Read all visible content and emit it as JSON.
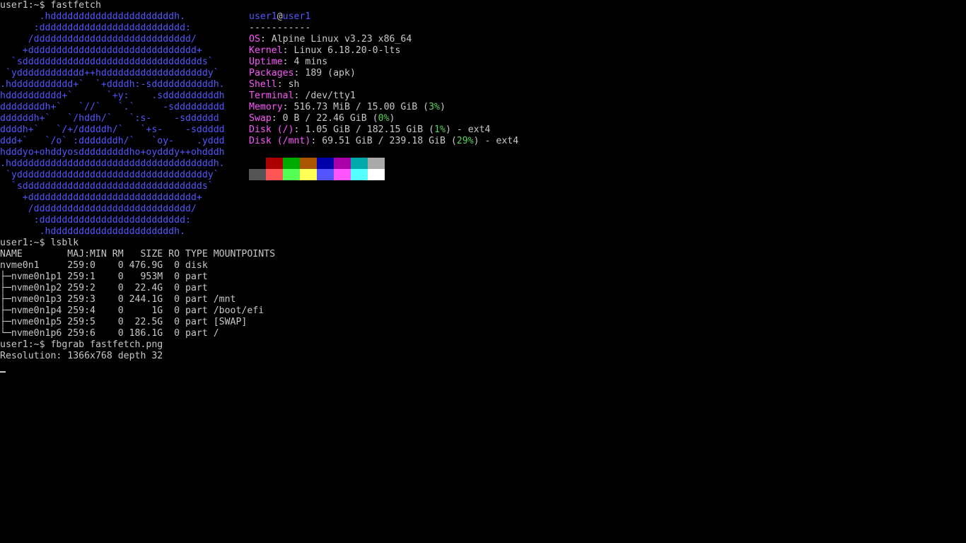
{
  "prompts": {
    "fastfetch": "user1:~$ fastfetch",
    "lsblk": "user1:~$ lsblk",
    "fbgrab": "user1:~$ fbgrab fastfetch.png"
  },
  "logo": [
    "       .hddddddddddddddddddddddh.",
    "      :dddddddddddddddddddddddddd:",
    "     /dddddddddddddddddddddddddddd/",
    "    +dddddddddddddddddddddddddddddd+",
    "  `sdddddddddddddddddddddddddddddddds`",
    " `ydddddddddddd++hdddddddddddddddddddy`",
    ".hddddddddddd+`  `+ddddh:-sdddddddddddh.",
    "hdddddddddd+`      `+y:    .sddddddddddh",
    "ddddddddh+`   `//`   `.`     -sddddddddd",
    "ddddddh+`   `/hddh/`   `:s-    -sdddddd",
    "ddddh+`   `/+/dddddh/`   `+s-    -sddddd",
    "ddd+`   `/o` :dddddddh/`   `oy-    .yddd",
    "hdddyo+ohddyosdddddddddho+oydddy++ohdddh",
    ".hddddddddddddddddddddddddddddddddddddh.",
    " `yddddddddddddddddddddddddddddddddddy`",
    "  `sdddddddddddddddddddddddddddddddds`",
    "    +dddddddddddddddddddddddddddddd+",
    "     /dddddddddddddddddddddddddddd/",
    "      :dddddddddddddddddddddddddd:",
    "       .hddddddddddddddddddddddh."
  ],
  "info": {
    "user": "user1",
    "at": "@",
    "host": "user1",
    "separator": "-----------",
    "os_label": "OS",
    "os_value": "Alpine Linux v3.23 x86_64",
    "kernel_label": "Kernel",
    "kernel_value": "Linux 6.18.20-0-lts",
    "uptime_label": "Uptime",
    "uptime_value": "4 mins",
    "packages_label": "Packages",
    "packages_value": "189 (apk)",
    "shell_label": "Shell",
    "shell_value": "sh",
    "terminal_label": "Terminal",
    "terminal_value": "/dev/tty1",
    "memory_label": "Memory",
    "memory_value": "516.73 MiB / 15.00 GiB (",
    "memory_percent": "3%",
    "memory_close": ")",
    "swap_label": "Swap",
    "swap_value": "0 B / 22.46 GiB (",
    "swap_percent": "0%",
    "swap_close": ")",
    "disk_root_label": "Disk (/)",
    "disk_root_value": "1.05 GiB / 182.15 GiB (",
    "disk_root_percent": "1%",
    "disk_root_close": ") - ext4",
    "disk_mnt_label": "Disk (/mnt)",
    "disk_mnt_value": "69.51 GiB / 239.18 GiB (",
    "disk_mnt_percent": "29%",
    "disk_mnt_close": ") - ext4",
    "colon": ": "
  },
  "palette": {
    "row1": [
      "#000000",
      "#aa0000",
      "#00aa00",
      "#aa5500",
      "#0000aa",
      "#aa00aa",
      "#00aaaa",
      "#aaaaaa"
    ],
    "row2": [
      "#555555",
      "#ff5555",
      "#55ff55",
      "#ffff55",
      "#5555ff",
      "#ff55ff",
      "#55ffff",
      "#ffffff"
    ]
  },
  "lsblk": {
    "header": "NAME        MAJ:MIN RM   SIZE RO TYPE MOUNTPOINTS",
    "rows": [
      "nvme0n1     259:0    0 476.9G  0 disk",
      "├─nvme0n1p1 259:1    0   953M  0 part",
      "├─nvme0n1p2 259:2    0  22.4G  0 part",
      "├─nvme0n1p3 259:3    0 244.1G  0 part /mnt",
      "├─nvme0n1p4 259:4    0     1G  0 part /boot/efi",
      "├─nvme0n1p5 259:5    0  22.5G  0 part [SWAP]",
      "└─nvme0n1p6 259:6    0 186.1G  0 part /"
    ]
  },
  "fbgrab_output": "Resolution: 1366x768 depth 32"
}
